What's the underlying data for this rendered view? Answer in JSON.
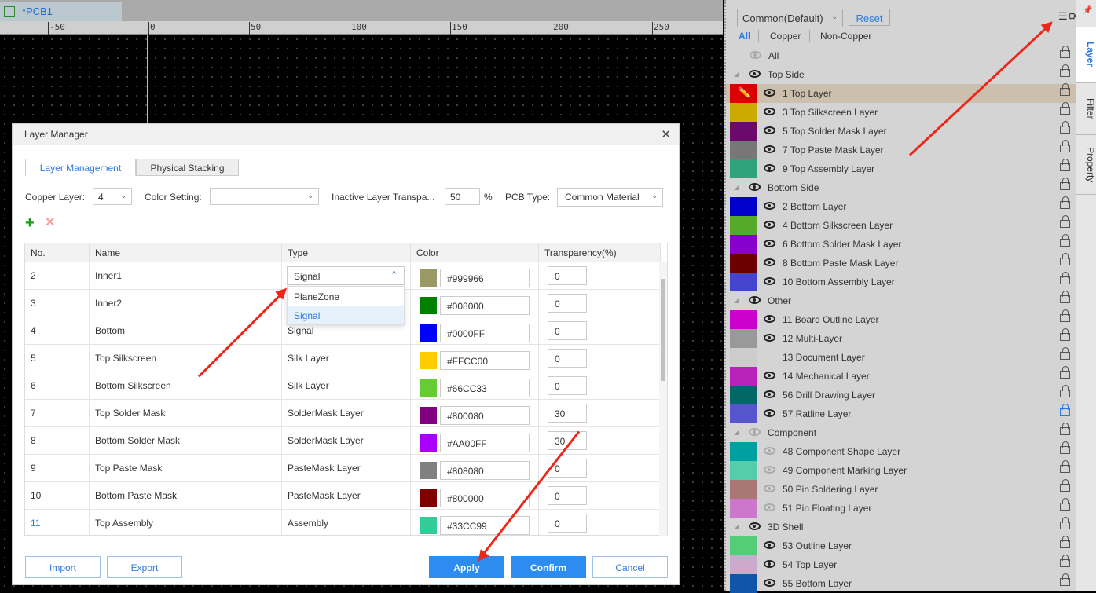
{
  "document_tab": {
    "title": "*PCB1"
  },
  "ruler": {
    "ticks": [
      "-50",
      "0",
      "50",
      "100",
      "150",
      "200",
      "250"
    ]
  },
  "dialog": {
    "title": "Layer Manager",
    "tabs": [
      {
        "label": "Layer Management",
        "active": true
      },
      {
        "label": "Physical Stacking",
        "active": false
      }
    ],
    "copper_layer": {
      "label": "Copper Layer:",
      "value": "4"
    },
    "color_setting": {
      "label": "Color Setting:",
      "value": ""
    },
    "inactive_transparency": {
      "label": "Inactive Layer Transpa...",
      "value": "50",
      "unit": "%"
    },
    "pcb_type": {
      "label": "PCB Type:",
      "value": "Common Material"
    },
    "columns": [
      "No.",
      "Name",
      "Type",
      "Color",
      "Transparency(%)"
    ],
    "rows": [
      {
        "no": "2",
        "name": "Inner1",
        "type": "Signal",
        "color": "#999966",
        "transparency": "0"
      },
      {
        "no": "3",
        "name": "Inner2",
        "type": "",
        "color": "#008000",
        "transparency": "0"
      },
      {
        "no": "4",
        "name": "Bottom",
        "type": "Signal",
        "color": "#0000FF",
        "transparency": "0"
      },
      {
        "no": "5",
        "name": "Top Silkscreen",
        "type": "Silk Layer",
        "color": "#FFCC00",
        "transparency": "0"
      },
      {
        "no": "6",
        "name": "Bottom Silkscreen",
        "type": "Silk Layer",
        "color": "#66CC33",
        "transparency": "0"
      },
      {
        "no": "7",
        "name": "Top Solder Mask",
        "type": "SolderMask Layer",
        "color": "#800080",
        "transparency": "30"
      },
      {
        "no": "8",
        "name": "Bottom Solder Mask",
        "type": "SolderMask Layer",
        "color": "#AA00FF",
        "transparency": "30"
      },
      {
        "no": "9",
        "name": "Top Paste Mask",
        "type": "PasteMask Layer",
        "color": "#808080",
        "transparency": "0"
      },
      {
        "no": "10",
        "name": "Bottom Paste Mask",
        "type": "PasteMask Layer",
        "color": "#800000",
        "transparency": "0"
      },
      {
        "no": "11",
        "name": "Top Assembly",
        "type": "Assembly",
        "color": "#33CC99",
        "transparency": "0"
      }
    ],
    "type_dropdown": {
      "options": [
        "PlaneZone",
        "Signal"
      ],
      "selected": "Signal"
    },
    "buttons": {
      "import": "Import",
      "export": "Export",
      "apply": "Apply",
      "confirm": "Confirm",
      "cancel": "Cancel"
    }
  },
  "panel": {
    "scheme": "Common(Default)",
    "reset": "Reset",
    "filters": [
      "All",
      "Copper",
      "Non-Copper"
    ],
    "rows": [
      {
        "label": "All",
        "kind": "all",
        "visible": false
      },
      {
        "label": "Top Side",
        "kind": "group",
        "visible": true
      },
      {
        "label": "1 Top Layer",
        "color": "#dd0000",
        "visible": true,
        "active": true
      },
      {
        "label": "3 Top Silkscreen Layer",
        "color": "#ccaa00",
        "visible": true
      },
      {
        "label": "5 Top Solder Mask Layer",
        "color": "#6a0a6a",
        "visible": true
      },
      {
        "label": "7 Top Paste Mask Layer",
        "color": "#777777",
        "visible": true
      },
      {
        "label": "9 Top Assembly Layer",
        "color": "#2fa37c",
        "visible": true
      },
      {
        "label": "Bottom Side",
        "kind": "group",
        "visible": true
      },
      {
        "label": "2 Bottom Layer",
        "color": "#0000cc",
        "visible": true
      },
      {
        "label": "4 Bottom Silkscreen Layer",
        "color": "#55aa2a",
        "visible": true
      },
      {
        "label": "6 Bottom Solder Mask Layer",
        "color": "#8800cc",
        "visible": true
      },
      {
        "label": "8 Bottom Paste Mask Layer",
        "color": "#6a0000",
        "visible": true
      },
      {
        "label": "10 Bottom Assembly Layer",
        "color": "#4444cc",
        "visible": true
      },
      {
        "label": "Other",
        "kind": "group",
        "visible": true
      },
      {
        "label": "11 Board Outline Layer",
        "color": "#cc00cc",
        "visible": true
      },
      {
        "label": "12 Multi-Layer",
        "color": "#999999",
        "visible": true
      },
      {
        "label": "13 Document Layer",
        "color": "#cccccc",
        "visible": null
      },
      {
        "label": "14 Mechanical Layer",
        "color": "#bb22bb",
        "visible": true
      },
      {
        "label": "56 Drill Drawing Layer",
        "color": "#006666",
        "visible": true
      },
      {
        "label": "57 Ratline Layer",
        "color": "#5555cc",
        "visible": true,
        "locked": true
      },
      {
        "label": "Component",
        "kind": "group",
        "visible": false
      },
      {
        "label": "48 Component Shape Layer",
        "color": "#00a0a0",
        "visible": false
      },
      {
        "label": "49 Component Marking Layer",
        "color": "#55ccaa",
        "visible": false
      },
      {
        "label": "50 Pin Soldering Layer",
        "color": "#aa7777",
        "visible": false
      },
      {
        "label": "51 Pin Floating Layer",
        "color": "#cc77cc",
        "visible": false
      },
      {
        "label": "3D Shell",
        "kind": "group",
        "visible": true
      },
      {
        "label": "53 Outline Layer",
        "color": "#55cc77",
        "visible": true
      },
      {
        "label": "54 Top Layer",
        "color": "#ccaacc",
        "visible": true
      },
      {
        "label": "55 Bottom Layer",
        "color": "#1155aa",
        "visible": true
      }
    ],
    "side_tabs": [
      "Layer",
      "Filter",
      "Property"
    ]
  },
  "colors": {
    "accent": "#2d8cf0",
    "annotation_arrow": "#f0251a"
  }
}
